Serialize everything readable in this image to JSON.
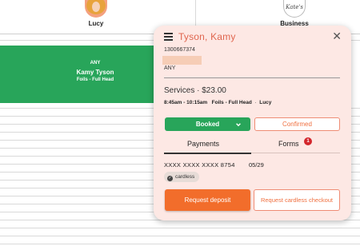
{
  "calendar": {
    "staff": [
      {
        "name": "Lucy"
      },
      {
        "name": "Business",
        "logo_text": "Kate's"
      }
    ],
    "appointment": {
      "line1": "ANY",
      "line2": "Kamy Tyson",
      "line3": "Foils - Full Head",
      "color": "#28a55a"
    }
  },
  "panel": {
    "title": "Tyson, Kamy",
    "phone": "1300667374",
    "location": "ANY",
    "services_heading": "Services · $23.00",
    "services_time": "8:45am - 10:15am",
    "services_name": "Foils - Full Head",
    "services_staff": "Lucy",
    "status_select": "Booked",
    "confirm_button": "Confirmed",
    "tabs": [
      {
        "label": "Payments",
        "active": true
      },
      {
        "label": "Forms",
        "badge": "1"
      }
    ],
    "payment": {
      "card_number": "XXXX XXXX XXXX 8754",
      "expiry": "05/29",
      "chip": "cardless"
    },
    "primary_button": "Request deposit",
    "secondary_button": "Request cardless checkout",
    "icons": {
      "menu": "menu-icon",
      "close": "close-icon",
      "chevron": "chevron-down-icon",
      "check": "check-circle-icon"
    },
    "colors": {
      "panel_bg": "#fde8e4",
      "accent": "#f26d2b",
      "title": "#e0664f",
      "booked": "#28a55a",
      "badge": "#d3262c"
    }
  }
}
